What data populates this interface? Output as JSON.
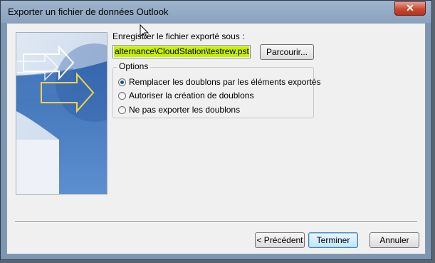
{
  "window": {
    "title": "Exporter un fichier de données Outlook",
    "close_glyph": "✕"
  },
  "form": {
    "save_label": "Enregistrer le fichier exporté sous :",
    "path_value": "alternance\\CloudStation\\testrew.pst",
    "browse_label": "Parcourir...",
    "options_legend": "Options",
    "options": [
      {
        "label": "Remplacer les doublons par les éléments exportés",
        "checked": true
      },
      {
        "label": "Autoriser la création de doublons",
        "checked": false
      },
      {
        "label": "Ne pas exporter les doublons",
        "checked": false
      }
    ]
  },
  "buttons": {
    "back": "< Précédent",
    "finish": "Terminer",
    "cancel": "Annuler"
  },
  "colors": {
    "highlight": "#c7f000",
    "title_bar": "#9fb4cc",
    "close_button": "#c9482f"
  },
  "icons": {
    "wizard_art": "outlook-export-arrows-icon",
    "close": "close-icon",
    "cursor": "mouse-cursor-icon"
  }
}
